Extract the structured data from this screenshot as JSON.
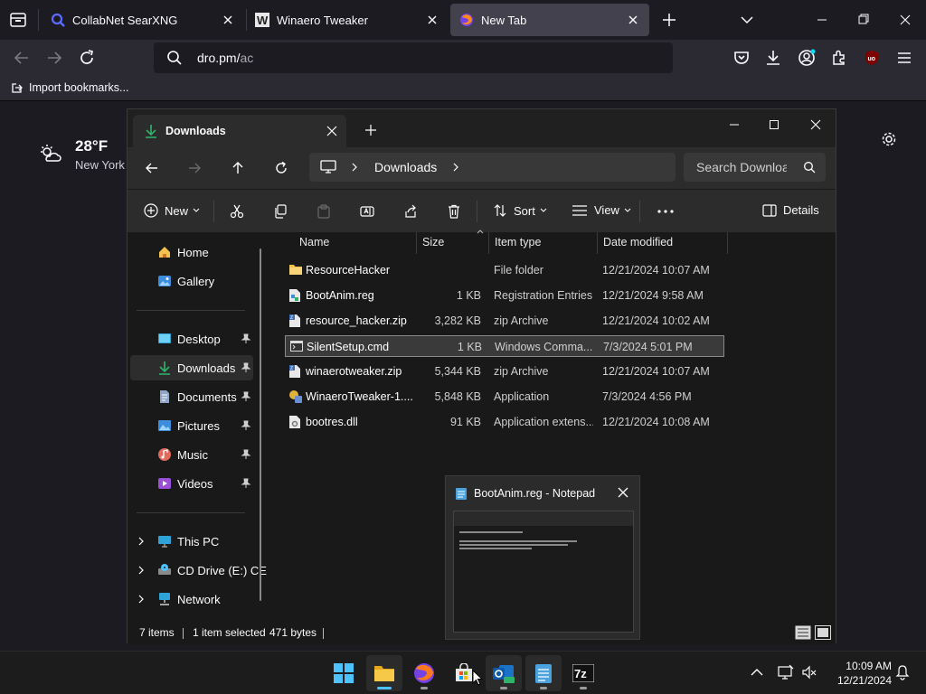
{
  "browser": {
    "tabs": [
      {
        "title": "CollabNet SearXNG",
        "icon": "magnifier-favicon"
      },
      {
        "title": "Winaero Tweaker",
        "icon": "winaero-favicon"
      },
      {
        "title": "New Tab",
        "icon": "firefox-favicon",
        "active": true
      }
    ],
    "url_text": "dro.pm/",
    "url_dim": "ac",
    "bookmarks_item": "Import bookmarks..."
  },
  "newtab": {
    "weather_temp": "28°F",
    "weather_city": "New York"
  },
  "explorer": {
    "tab_title": "Downloads",
    "breadcrumb": "Downloads",
    "search_placeholder": "Search Downloads",
    "commands": {
      "new": "New",
      "sort": "Sort",
      "view": "View",
      "details": "Details"
    },
    "sidebar": {
      "quick": [
        {
          "label": "Home",
          "icon": "home-icon"
        },
        {
          "label": "Gallery",
          "icon": "gallery-icon"
        }
      ],
      "pinned": [
        {
          "label": "Desktop",
          "icon": "desktop-folder-icon"
        },
        {
          "label": "Downloads",
          "icon": "downloads-folder-icon",
          "selected": true
        },
        {
          "label": "Documents",
          "icon": "documents-folder-icon"
        },
        {
          "label": "Pictures",
          "icon": "pictures-folder-icon"
        },
        {
          "label": "Music",
          "icon": "music-folder-icon"
        },
        {
          "label": "Videos",
          "icon": "videos-folder-icon"
        }
      ],
      "devices": [
        {
          "label": "This PC",
          "icon": "pc-icon"
        },
        {
          "label": "CD Drive (E:) CE",
          "icon": "cd-drive-icon"
        },
        {
          "label": "Network",
          "icon": "network-icon"
        }
      ]
    },
    "columns": {
      "name": "Name",
      "size": "Size",
      "type": "Item type",
      "date": "Date modified"
    },
    "files": [
      {
        "name": "ResourceHacker",
        "size": "",
        "type": "File folder",
        "date": "12/21/2024 10:07 AM",
        "icon": "folder-icon"
      },
      {
        "name": "BootAnim.reg",
        "size": "1 KB",
        "type": "Registration Entries",
        "date": "12/21/2024 9:58 AM",
        "icon": "reg-file-icon"
      },
      {
        "name": "resource_hacker.zip",
        "size": "3,282 KB",
        "type": "zip Archive",
        "date": "12/21/2024 10:02 AM",
        "icon": "zip-file-icon"
      },
      {
        "name": "SilentSetup.cmd",
        "size": "1 KB",
        "type": "Windows Comma...",
        "date": "7/3/2024 5:01 PM",
        "icon": "cmd-file-icon",
        "selected": true
      },
      {
        "name": "winaerotweaker.zip",
        "size": "5,344 KB",
        "type": "zip Archive",
        "date": "12/21/2024 10:07 AM",
        "icon": "zip-file-icon"
      },
      {
        "name": "WinaeroTweaker-1....",
        "size": "5,848 KB",
        "type": "Application",
        "date": "7/3/2024 4:56 PM",
        "icon": "installer-icon"
      },
      {
        "name": "bootres.dll",
        "size": "91 KB",
        "type": "Application extens...",
        "date": "12/21/2024 10:08 AM",
        "icon": "dll-file-icon"
      }
    ],
    "status": {
      "count": "7 items",
      "selection": "1 item selected",
      "bytes": "471 bytes"
    }
  },
  "notepad_thumb": {
    "title": "BootAnim.reg - Notepad"
  },
  "taskbar": {
    "time": "10:09 AM",
    "date": "12/21/2024",
    "apps": [
      "start",
      "file-explorer",
      "firefox",
      "microsoft-store",
      "outlook-new",
      "notepad",
      "7-zip"
    ]
  },
  "colors": {
    "accent": "#4cc2ff",
    "folder": "#f2c14e",
    "download": "#2fb36b"
  }
}
